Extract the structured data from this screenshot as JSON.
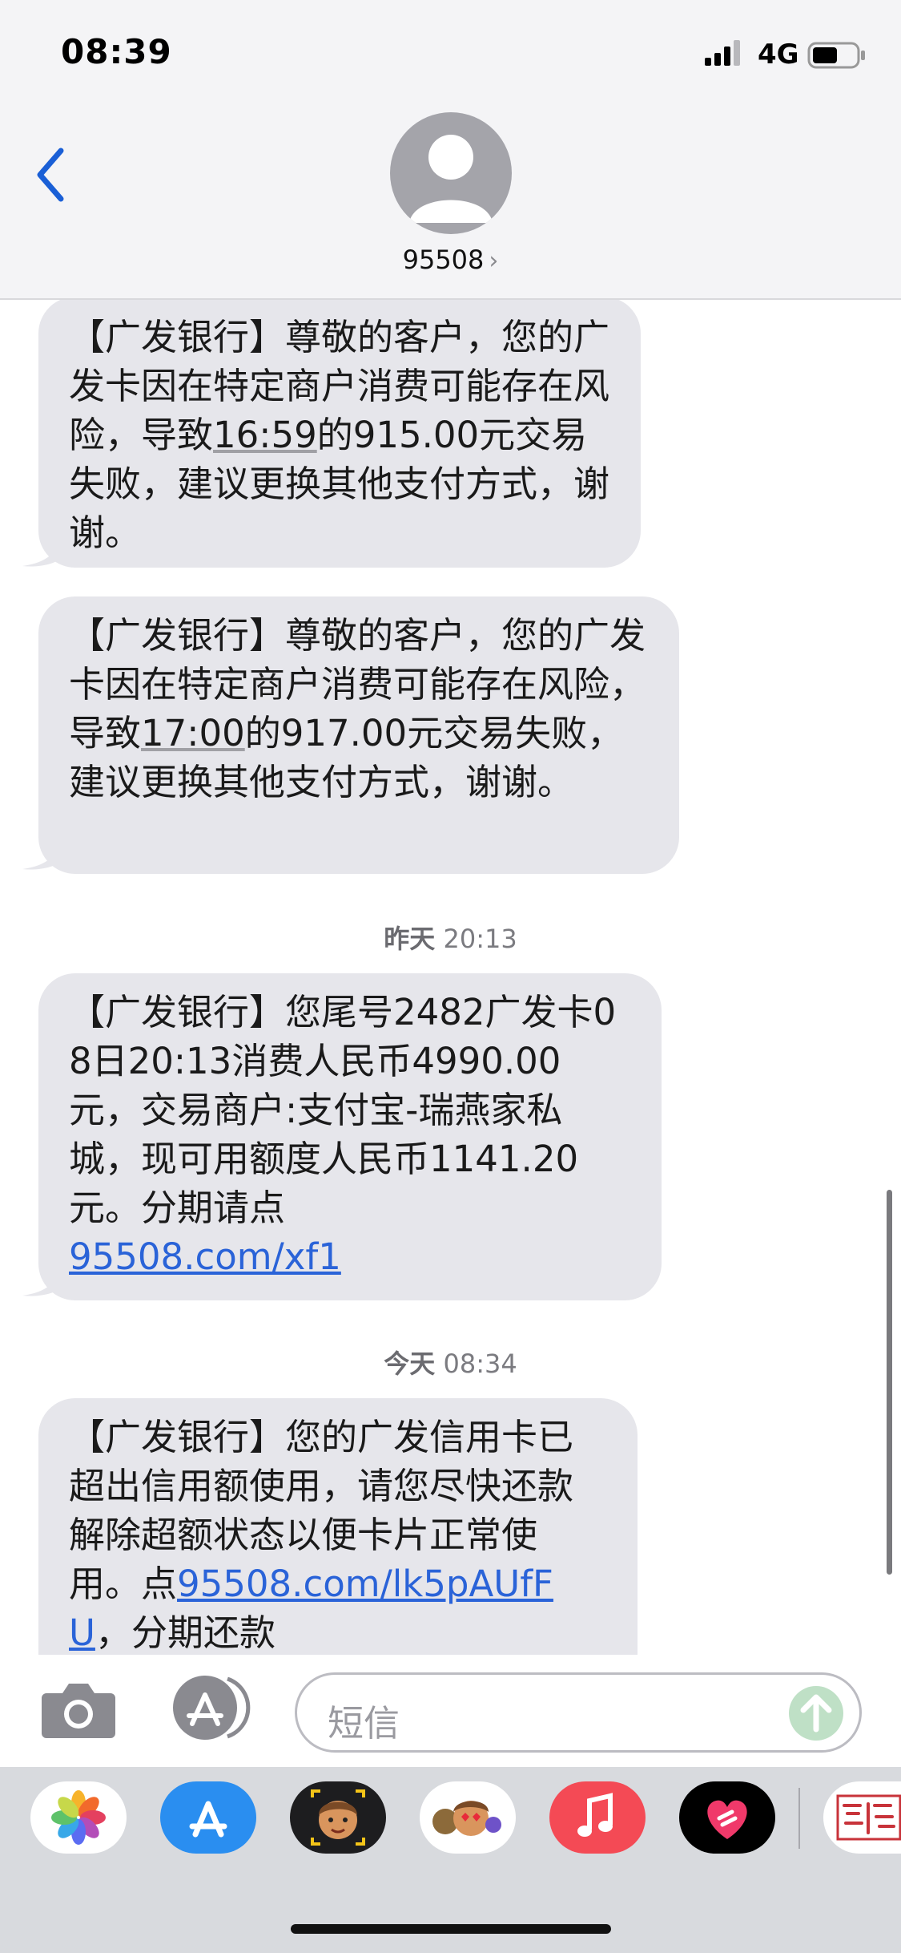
{
  "status_bar": {
    "time": "08:39",
    "network": "4G"
  },
  "header": {
    "contact": "95508",
    "chevron": "›"
  },
  "messages": [
    {
      "text_a": "【广发银行】尊敬的客户，您的广发卡因在特定商户消费可能存在风险，导致",
      "time_ref": "16:59",
      "text_b": "的915.00元交易失败，建议更换其他支付方式，谢谢。"
    },
    {
      "text_a": "【广发银行】尊敬的客户，您的广发卡因在特定商户消费可能存在风险，导致",
      "time_ref": "17:00",
      "text_b": "的917.00元交易失败，建议更换其他支付方式，谢谢。"
    },
    {
      "text_a": "【广发银行】您尾号2482广发卡08日20:13消费人民币4990.00元，交易商户:支付宝-瑞燕家私城，现可用额度人民币1141.20元。分期请点",
      "link": "95508.com/xf1"
    },
    {
      "text_a": "【广发银行】您的广发信用卡已超出信用额使用，请您尽快还款解除超额状态以便卡片正常使用。点",
      "link": "95508.com/lk5pAUfFU",
      "text_b": "，分期还款"
    }
  ],
  "timestamps": [
    {
      "day": "昨天",
      "time": "20:13"
    },
    {
      "day": "今天",
      "time": "08:34"
    }
  ],
  "input": {
    "placeholder": "短信"
  },
  "drawer": {
    "apps": [
      "photos-icon",
      "app-store-icon",
      "memoji-icon",
      "memoji-stickers-icon",
      "music-icon",
      "digital-touch-icon",
      "stamp-app-icon"
    ]
  },
  "colors": {
    "bubble": "#e6e6eb",
    "link": "#2a63d8",
    "back": "#1a5fd6",
    "send": "#bfe0c6",
    "music": "#f44a55",
    "appstore": "#2a8ef0"
  }
}
